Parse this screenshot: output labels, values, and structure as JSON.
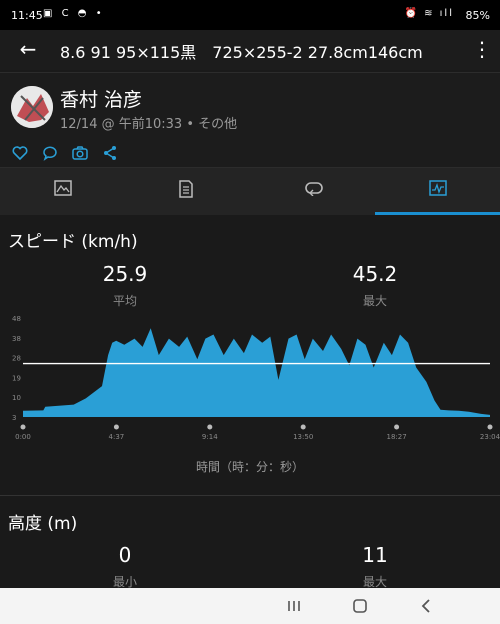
{
  "status": {
    "time": "11:45",
    "left_icons": "▣ C ◓ •",
    "right_icons": "⏰ ≋ ıll",
    "battery": "85%"
  },
  "toolbar": {
    "title": "8.6 91 95×115黒　725×255-2 27.8cm146cm"
  },
  "profile": {
    "name": "香村 治彦",
    "meta": "12/14 @ 午前10:33 • その他"
  },
  "social": {
    "icons": [
      "heart-icon",
      "comment-icon",
      "camera-icon",
      "share-icon"
    ]
  },
  "tabs": [
    {
      "name": "overview",
      "icon": "map-icon"
    },
    {
      "name": "details",
      "icon": "document-icon"
    },
    {
      "name": "laps",
      "icon": "laps-icon"
    },
    {
      "name": "charts",
      "icon": "chart-icon"
    }
  ],
  "speed": {
    "title": "スピード (km/h)",
    "avg_value": "25.9",
    "avg_label": "平均",
    "max_value": "45.2",
    "max_label": "最大"
  },
  "chart_data": {
    "type": "area",
    "x_ticks": [
      "0:00",
      "4:37",
      "9:14",
      "13:50",
      "18:27",
      "23:04"
    ],
    "y_ticks": [
      "3",
      "10",
      "19",
      "28",
      "38",
      "48"
    ],
    "ylim": [
      0,
      48
    ],
    "xlabel": "時間（時：分：秒）",
    "avg_line": 25.9,
    "color": "#2a9fd6",
    "series": [
      {
        "x": [
          0,
          1,
          1.1,
          2.5,
          3.1,
          3.9,
          4.2,
          4.4,
          4.6,
          5.0,
          5.5,
          5.9,
          6.3,
          6.7,
          7.2,
          7.7,
          8.1,
          8.6,
          9.0,
          9.4,
          9.9,
          10.4,
          10.9,
          11.3,
          11.8,
          12.2,
          12.6,
          13.1,
          13.5,
          13.9,
          14.3,
          14.8,
          15.2,
          15.7,
          16.1,
          16.5,
          16.9,
          17.3,
          17.8,
          18.2,
          18.6,
          19.0,
          19.4,
          19.9,
          20.3,
          20.6,
          21.0,
          21.5,
          22.0,
          22.6,
          23.04
        ],
        "y": [
          3,
          3.2,
          5,
          6,
          9,
          15,
          30,
          36,
          37,
          35,
          38,
          34,
          43,
          30,
          38,
          34,
          39,
          28,
          38,
          40,
          30,
          38,
          31,
          40,
          36,
          39,
          18,
          38,
          40,
          28,
          38,
          32,
          40,
          33,
          25,
          38,
          35,
          24,
          36,
          30,
          40,
          36,
          24,
          17,
          8,
          3.5,
          3.2,
          3,
          2.5,
          1.5,
          1
        ]
      }
    ]
  },
  "altitude": {
    "title": "高度 (m)",
    "min_value": "0",
    "min_label": "最小",
    "max_value": "11",
    "max_label": "最大"
  },
  "navbar": {
    "icons": [
      "recent-apps-icon",
      "home-icon",
      "back-icon"
    ]
  }
}
